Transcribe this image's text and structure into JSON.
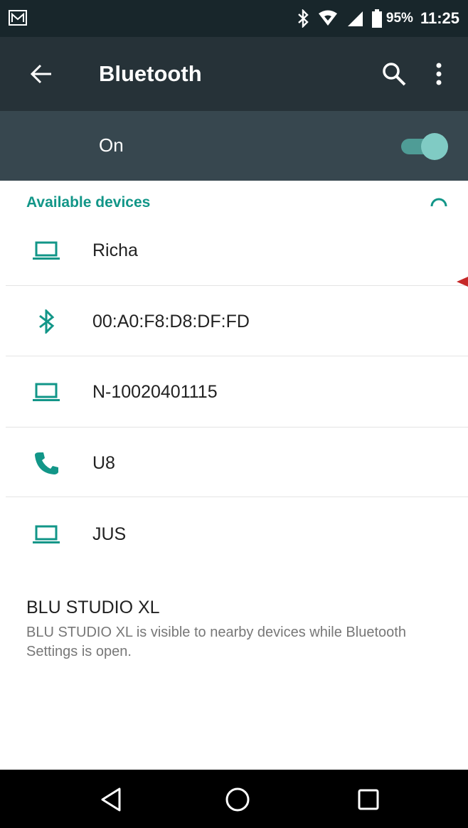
{
  "status_bar": {
    "battery": "95%",
    "time": "11:25",
    "icons": [
      "gmail-icon",
      "bluetooth-icon",
      "wifi-icon",
      "signal-icon",
      "battery-icon"
    ]
  },
  "app_bar": {
    "title": "Bluetooth",
    "icons": [
      "back-arrow-icon",
      "search-icon",
      "more-vert-icon"
    ]
  },
  "bluetooth_switch": {
    "label": "On",
    "checked": true,
    "accent_color": "#80cbc4"
  },
  "available_devices": {
    "header": "Available devices",
    "accent_color": "#129688",
    "devices": [
      {
        "name": "Richa",
        "icon": "laptop-icon"
      },
      {
        "name": "00:A0:F8:D8:DF:FD",
        "icon": "bluetooth-icon"
      },
      {
        "name": "N-10020401115",
        "icon": "laptop-icon"
      },
      {
        "name": "U8",
        "icon": "phone-icon"
      },
      {
        "name": "JUS",
        "icon": "laptop-icon"
      }
    ]
  },
  "footer": {
    "title": "BLU STUDIO XL",
    "description": "BLU STUDIO XL is visible to nearby devices while Bluetooth Settings is open."
  },
  "nav_bar": {
    "icons": [
      "nav-back-icon",
      "nav-home-icon",
      "nav-recents-icon"
    ]
  }
}
